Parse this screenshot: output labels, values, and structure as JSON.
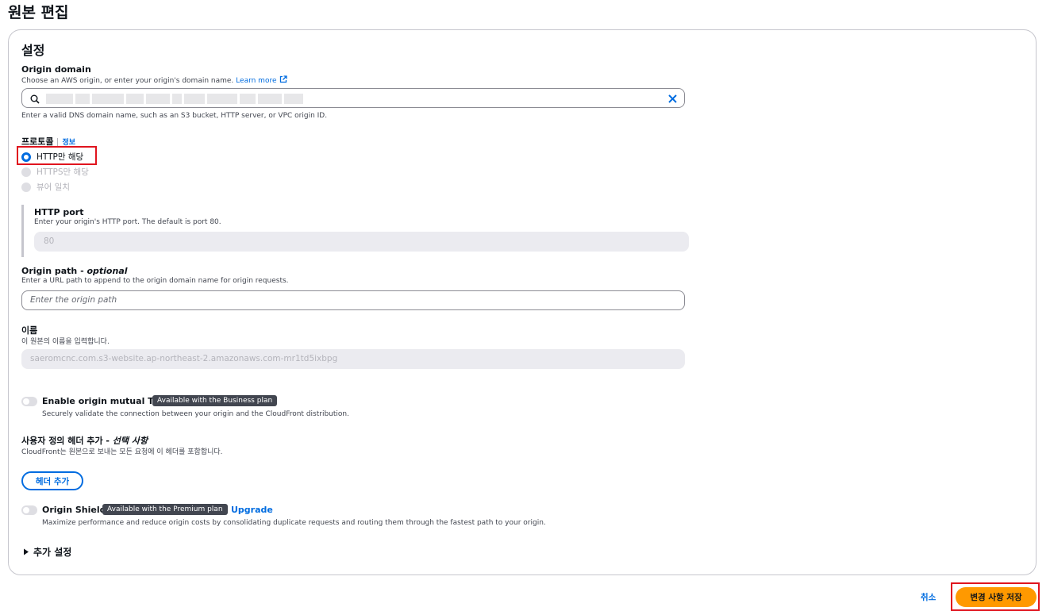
{
  "page_title": "원본 편집",
  "section_title": "설정",
  "origin_domain": {
    "label": "Origin domain",
    "description": "Choose an AWS origin, or enter your origin's domain name.",
    "learn_more": "Learn more",
    "hint": "Enter a valid DNS domain name, such as an S3 bucket, HTTP server, or VPC origin ID.",
    "value_redacted": true
  },
  "protocol": {
    "label": "프로토콜",
    "info": "정보",
    "options": [
      {
        "label": "HTTP만 해당",
        "selected": true,
        "disabled": false
      },
      {
        "label": "HTTPS만 해당",
        "selected": false,
        "disabled": true
      },
      {
        "label": "뷰어 일치",
        "selected": false,
        "disabled": true
      }
    ]
  },
  "http_port": {
    "label": "HTTP port",
    "description": "Enter your origin's HTTP port. The default is port 80.",
    "value": "80"
  },
  "origin_path": {
    "label": "Origin path - ",
    "label_optional": "optional",
    "description": "Enter a URL path to append to the origin domain name for origin requests.",
    "placeholder": "Enter the origin path"
  },
  "name": {
    "label": "이름",
    "description": "이 원본의 이름을 입력합니다.",
    "value": "saeromcnc.com.s3-website.ap-northeast-2.amazonaws.com-mr1td5ixbpg"
  },
  "mutual_tls": {
    "label": "Enable origin mutual TLS",
    "badge": "Available with the Business plan",
    "description": "Securely validate the connection between your origin and the CloudFront distribution.",
    "enabled": false
  },
  "custom_headers": {
    "label": "사용자 정의 헤더 추가 - ",
    "label_optional": "선택 사항",
    "description": "CloudFront는 원본으로 보내는 모든 요청에 이 헤더를 포함합니다.",
    "button": "헤더 추가"
  },
  "origin_shield": {
    "label": "Origin Shield",
    "badge": "Available with the Premium plan",
    "upgrade": "Upgrade",
    "description": "Maximize performance and reduce origin costs by consolidating duplicate requests and routing them through the fastest path to your origin.",
    "enabled": false
  },
  "additional_settings": "추가 설정",
  "footer": {
    "cancel": "취소",
    "save": "변경 사항 저장"
  },
  "colors": {
    "accent": "#006ce0",
    "primary_button": "#ff9900",
    "highlight": "#e0141e"
  }
}
